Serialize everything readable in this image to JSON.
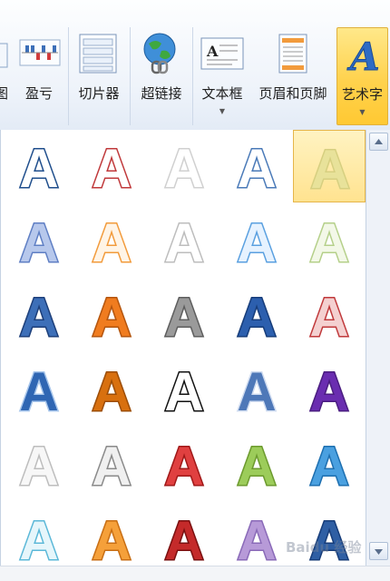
{
  "ribbon": {
    "items": [
      {
        "id": "partial-chart",
        "label": "图",
        "icon": "chart-icon"
      },
      {
        "id": "winloss",
        "label": "盈亏",
        "icon": "winloss-sparkline-icon"
      },
      {
        "id": "slicer",
        "label": "切片器",
        "icon": "slicer-icon"
      },
      {
        "id": "hyperlink",
        "label": "超链接",
        "icon": "hyperlink-globe-icon"
      },
      {
        "id": "textbox",
        "label": "文本框",
        "icon": "textbox-icon"
      },
      {
        "id": "header-footer",
        "label": "页眉和页脚",
        "icon": "header-footer-icon"
      },
      {
        "id": "wordart",
        "label": "艺术字",
        "icon": "wordart-icon"
      }
    ]
  },
  "gallery": {
    "glyph": "A",
    "selected_index": 4,
    "styles": [
      {
        "fill": "#ffffff",
        "stroke": "#1f4e8c"
      },
      {
        "fill": "#ffffff",
        "stroke": "#c0393b"
      },
      {
        "fill": "#ffffff",
        "stroke": "#d0d0d0"
      },
      {
        "fill": "#ffffff",
        "stroke": "#4a7ab8"
      },
      {
        "fill": "#e8e29a",
        "stroke": "#d6cf80"
      },
      {
        "fill": "#b7c8ec",
        "stroke": "#5f7fc4"
      },
      {
        "fill": "#fff4e6",
        "stroke": "#f29b3c"
      },
      {
        "fill": "#ffffff",
        "stroke": "#bdbdbd"
      },
      {
        "fill": "#e6f2ff",
        "stroke": "#5aa0e0"
      },
      {
        "fill": "#f3f8e8",
        "stroke": "#b5d08a"
      },
      {
        "fill": "#3d6fb8",
        "stroke": "#1d3f7a"
      },
      {
        "fill": "#f07c1f",
        "stroke": "#b4550e"
      },
      {
        "fill": "#9a9a9a",
        "stroke": "#5e5e5e"
      },
      {
        "fill": "#2c5fae",
        "stroke": "#173d7a"
      },
      {
        "fill": "#f4d0d0",
        "stroke": "#c0393b"
      },
      {
        "fill": "#2f66b3",
        "stroke": "#a9c7ec"
      },
      {
        "fill": "#d8700f",
        "stroke": "#9c4d07"
      },
      {
        "fill": "#ffffff",
        "stroke": "#111111"
      },
      {
        "fill": "#4e78b8",
        "stroke": "#d0dcf0"
      },
      {
        "fill": "#6a2db0",
        "stroke": "#4a1d80"
      },
      {
        "fill": "#f7f7f7",
        "stroke": "#bdbdbd"
      },
      {
        "fill": "#f0f0f0",
        "stroke": "#8a8a8a"
      },
      {
        "fill": "#e04040",
        "stroke": "#a01818"
      },
      {
        "fill": "#9ccc5a",
        "stroke": "#6c9a2e"
      },
      {
        "fill": "#4aa0e0",
        "stroke": "#1d6fb0"
      },
      {
        "fill": "#e6f6fb",
        "stroke": "#5bb8d8"
      },
      {
        "fill": "#f5a03a",
        "stroke": "#c86e14"
      },
      {
        "fill": "#c42a2a",
        "stroke": "#7a1010"
      },
      {
        "fill": "#b79ad8",
        "stroke": "#8a6ab8"
      },
      {
        "fill": "#2f5fa4",
        "stroke": "#173d7a"
      }
    ]
  },
  "watermark": "Baidu 经验"
}
